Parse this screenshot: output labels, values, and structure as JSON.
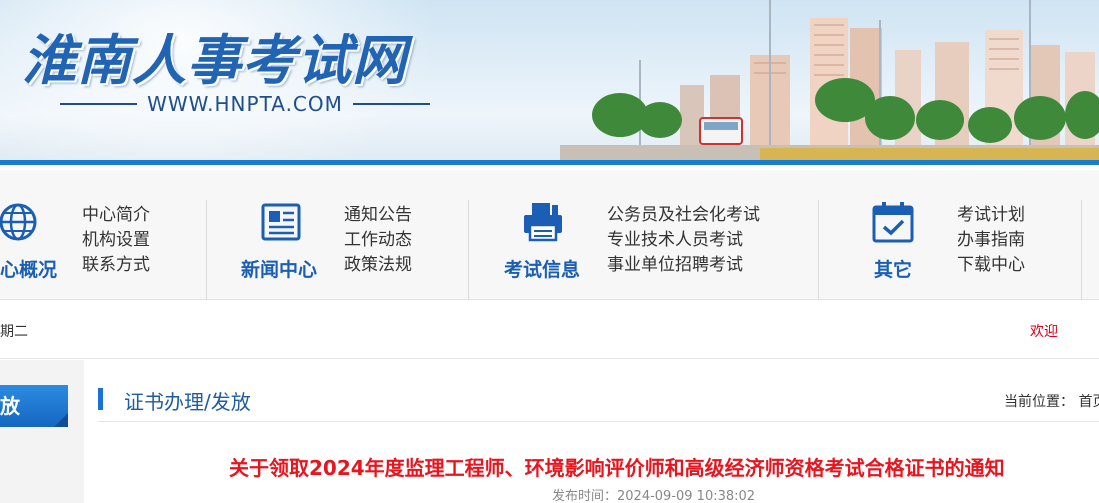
{
  "banner": {
    "site_title": "淮南人事考试网",
    "site_url": "WWW.HNPTA.COM"
  },
  "nav": {
    "blocks": [
      {
        "category": "心概况",
        "icon": "globe-icon",
        "links": [
          "中心简介",
          "机构设置",
          "联系方式"
        ]
      },
      {
        "category": "新闻中心",
        "icon": "newspaper-icon",
        "links": [
          "通知公告",
          "工作动态",
          "政策法规"
        ]
      },
      {
        "category": "考试信息",
        "icon": "printer-icon",
        "links": [
          "公务员及社会化考试",
          "专业技术人员考试",
          "事业单位招聘考试"
        ]
      },
      {
        "category": "其它",
        "icon": "calendar-check-icon",
        "links": [
          "考试计划",
          "办事指南",
          "下载中心"
        ]
      }
    ]
  },
  "infobar": {
    "date_text": "期二",
    "welcome_text": "欢迎"
  },
  "sidebar": {
    "active_tab": "放"
  },
  "content": {
    "section_title": "证书办理/发放",
    "breadcrumb": "当前位置：  首页",
    "article_title": "关于领取2024年度监理工程师、环境影响评价师和高级经济师资格考试合格证书的通知",
    "publish_time": "发布时间：2024-09-09 10:38:02"
  },
  "colors": {
    "brand_blue": "#1a5fb4",
    "accent_red": "#e8151e",
    "welcome_red": "#d9001b"
  }
}
